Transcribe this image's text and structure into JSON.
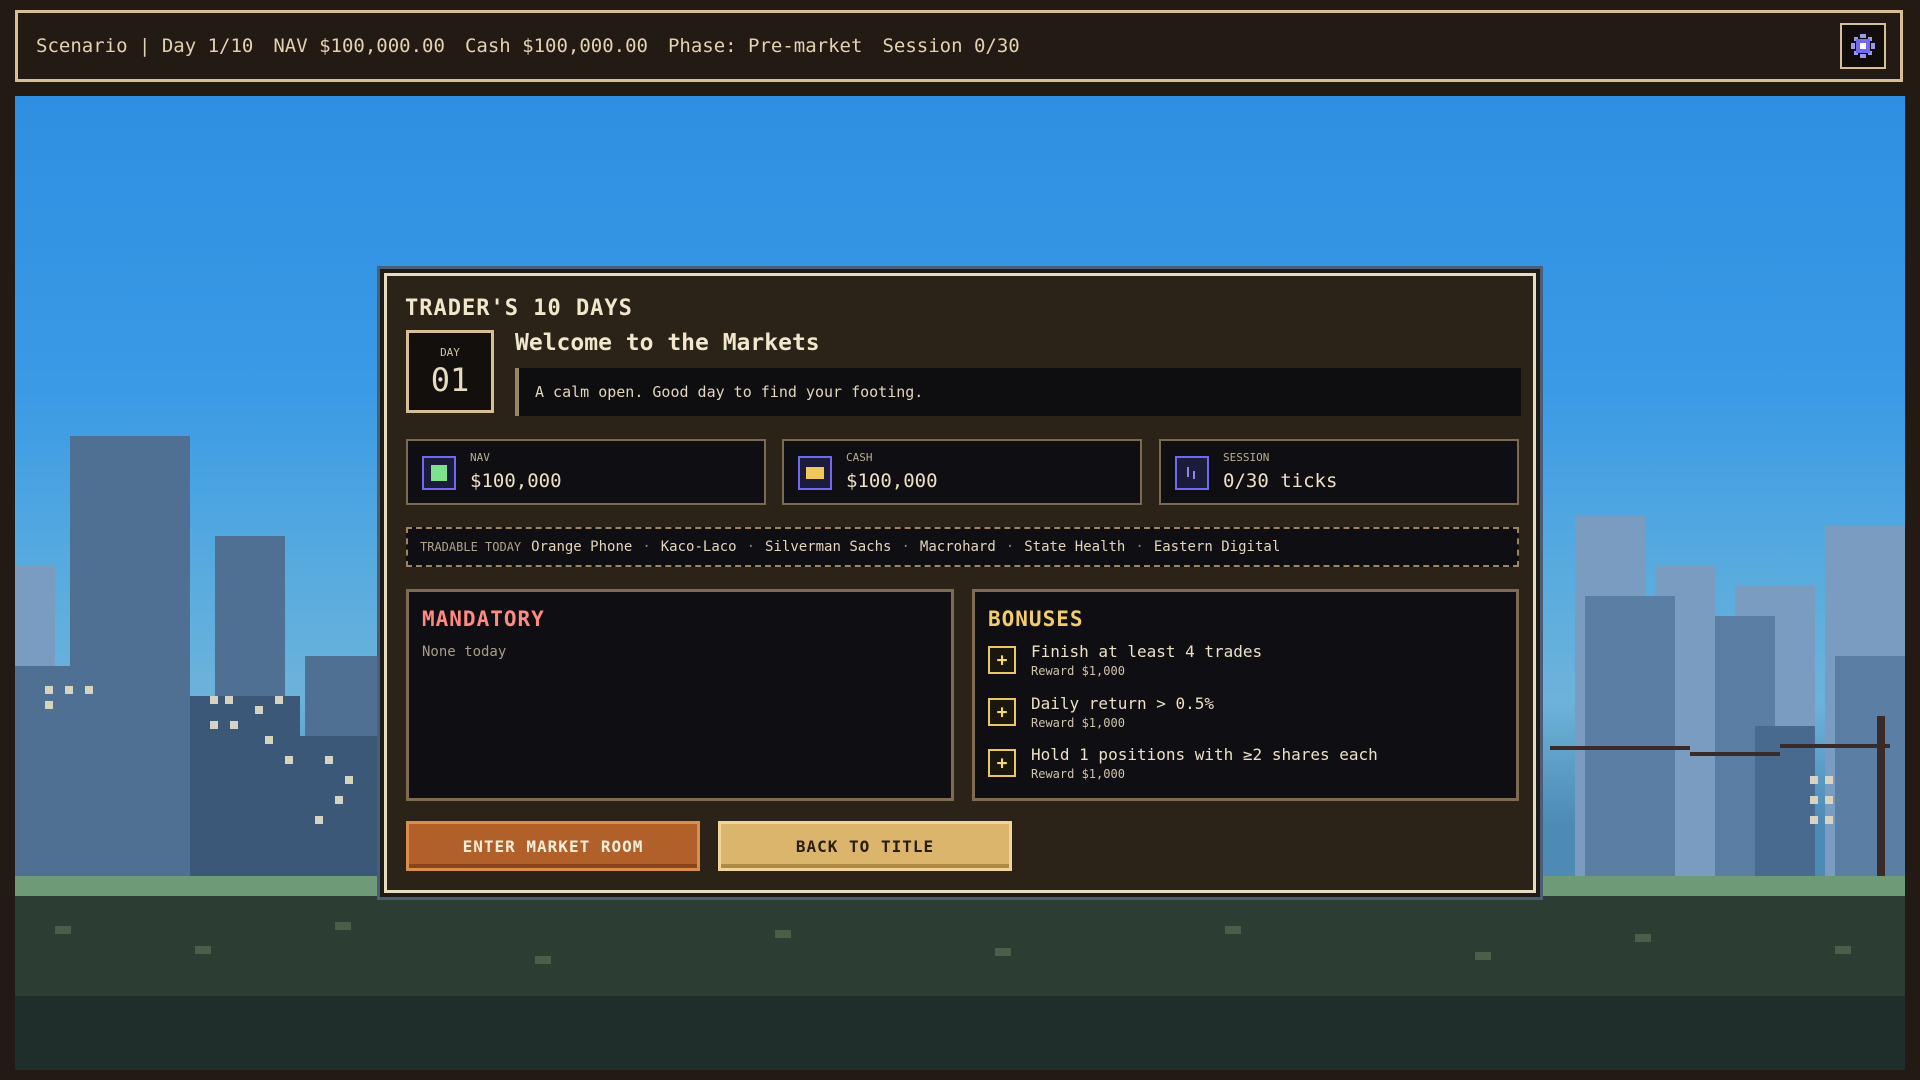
{
  "topbar": {
    "scenario": "Scenario | Day 1/10",
    "nav": "NAV $100,000.00",
    "cash": "Cash $100,000.00",
    "phase": "Phase: Pre-market",
    "session": "Session 0/30",
    "settings_icon": "gear-icon"
  },
  "dialog": {
    "title": "TRADER'S 10 DAYS",
    "day_label": "DAY",
    "day_number": "01",
    "heading": "Welcome to the Markets",
    "flavor": "A calm open. Good day to find your footing.",
    "stats": [
      {
        "label": "NAV",
        "value": "$100,000",
        "icon": "nav-icon",
        "icon_color": "#7ce38c"
      },
      {
        "label": "CASH",
        "value": "$100,000",
        "icon": "cash-icon",
        "icon_color": "#f0c75a"
      },
      {
        "label": "SESSION",
        "value": "0/30 ticks",
        "icon": "session-icon",
        "icon_color": "#8b86f0"
      }
    ],
    "tradable_label": "TRADABLE TODAY",
    "tradable": [
      "Orange Phone",
      "Kaco-Laco",
      "Silverman Sachs",
      "Macrohard",
      "State Health",
      "Eastern Digital"
    ],
    "tradable_separator": "·",
    "mandatory": {
      "title": "MANDATORY",
      "empty": "None today",
      "color": "#ff8a80"
    },
    "bonuses": {
      "title": "BONUSES",
      "color": "#f2cc6a",
      "items": [
        {
          "text": "Finish at least 4 trades",
          "reward": "Reward $1,000"
        },
        {
          "text": "Daily return > 0.5%",
          "reward": "Reward $1,000"
        },
        {
          "text": "Hold 1 positions with ≥2 shares each",
          "reward": "Reward $1,000"
        }
      ]
    },
    "buttons": {
      "enter": "ENTER MARKET ROOM",
      "back": "BACK TO TITLE"
    }
  }
}
